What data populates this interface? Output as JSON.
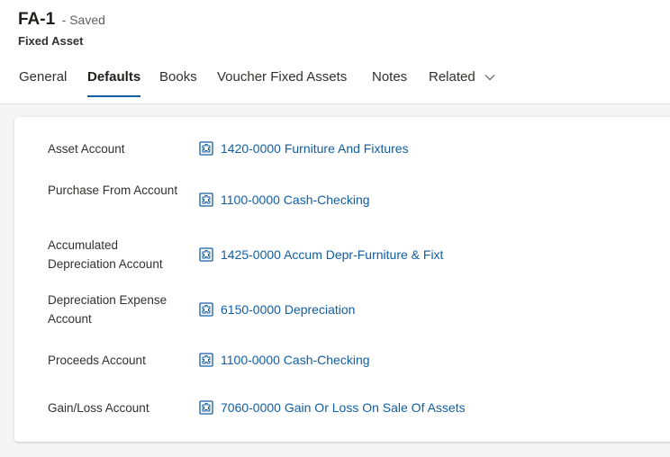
{
  "header": {
    "title": "FA-1",
    "status": "- Saved",
    "entity": "Fixed Asset"
  },
  "tabs": [
    "General",
    "Defaults",
    "Books",
    "Voucher Fixed Assets",
    "Notes",
    "Related"
  ],
  "active_tab": "Defaults",
  "fields": [
    {
      "label": "Asset Account",
      "value": "1420-0000 Furniture And Fixtures"
    },
    {
      "label": "Purchase From Account",
      "value": "1100-0000 Cash-Checking"
    },
    {
      "label": "Accumulated Depreciation Account",
      "value": "1425-0000 Accum Depr-Furniture & Fixt"
    },
    {
      "label": "Depreciation Expense Account",
      "value": "6150-0000 Depreciation"
    },
    {
      "label": "Proceeds Account",
      "value": "1100-0000 Cash-Checking"
    },
    {
      "label": "Gain/Loss Account",
      "value": "7060-0000 Gain Or Loss On Sale Of Assets"
    }
  ],
  "colors": {
    "link": "#115ea3",
    "accent": "#115ea3",
    "background": "#f5f5f5"
  }
}
